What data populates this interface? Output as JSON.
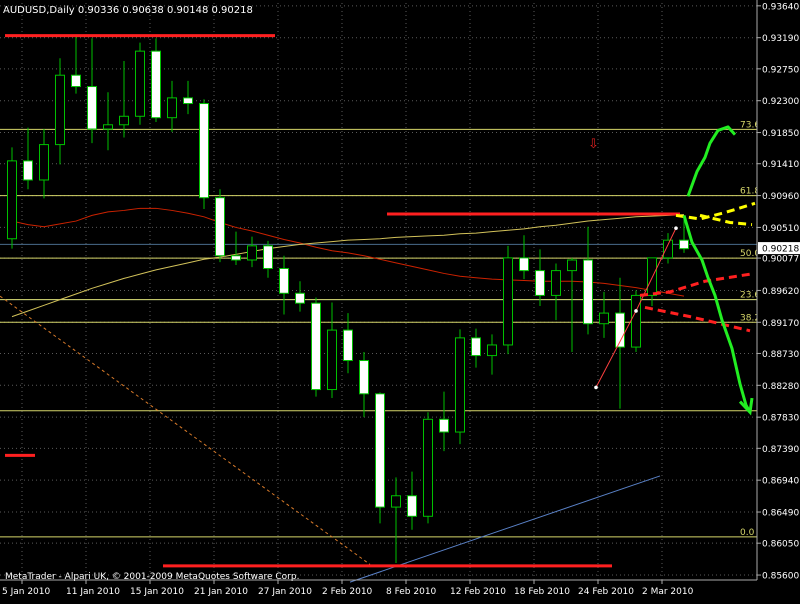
{
  "header": {
    "symbol_line": "AUDUSD,Daily  0.90336 0.90638 0.90148 0.90218",
    "arrow_marker": "⇩"
  },
  "footer": {
    "copyright": "MetaTrader - Alpari UK, © 2001-2009 MetaQuotes Software Corp."
  },
  "colors": {
    "background": "#000000",
    "grid": "#5a5a5a",
    "axis_text": "#ffffff",
    "bull_body": "#000000",
    "bear_body": "#ffffff",
    "wick": "#00c000",
    "candle_outline": "#00c000",
    "ma_red": "#cc2200",
    "ma_yellow": "#d2c25a",
    "fib": "#d6d66a",
    "hline_blue": "#4a6c8c",
    "trend_blue": "#5a82c8",
    "trend_orange": "#d77a2a",
    "red_level": "#ff2020",
    "green_path": "#22ee22",
    "yellow_dash": "#ffff00",
    "current_price_bg": "#ffffff"
  },
  "chart_data": {
    "type": "candlestick",
    "title": "AUDUSD,Daily  0.90336 0.90638 0.90148 0.90218",
    "ylim": [
      0.8553,
      0.9368
    ],
    "y_ticks": [
      "0.93640",
      "0.93190",
      "0.92750",
      "0.92300",
      "0.91850",
      "0.91410",
      "0.90960",
      "0.90510",
      "0.90077",
      "0.89620",
      "0.89170",
      "0.88730",
      "0.88280",
      "0.87830",
      "0.87390",
      "0.86940",
      "0.86490",
      "0.86050",
      "0.85600"
    ],
    "current_price": "0.90218",
    "x_ticks": [
      "5 Jan 2010",
      "11 Jan 2010",
      "15 Jan 2010",
      "21 Jan 2010",
      "27 Jan 2010",
      "2 Feb 2010",
      "8 Feb 2010",
      "12 Feb 2010",
      "18 Feb 2010",
      "24 Feb 2010",
      "2 Mar 2010"
    ],
    "candles": [
      {
        "o": 0.9035,
        "h": 0.9164,
        "l": 0.9021,
        "c": 0.9145
      },
      {
        "o": 0.9145,
        "h": 0.9192,
        "l": 0.9105,
        "c": 0.9118
      },
      {
        "o": 0.9118,
        "h": 0.919,
        "l": 0.9092,
        "c": 0.9168
      },
      {
        "o": 0.9168,
        "h": 0.929,
        "l": 0.914,
        "c": 0.9266
      },
      {
        "o": 0.9266,
        "h": 0.932,
        "l": 0.924,
        "c": 0.925
      },
      {
        "o": 0.925,
        "h": 0.9318,
        "l": 0.917,
        "c": 0.919
      },
      {
        "o": 0.919,
        "h": 0.9242,
        "l": 0.916,
        "c": 0.9196
      },
      {
        "o": 0.9196,
        "h": 0.9286,
        "l": 0.9178,
        "c": 0.9208
      },
      {
        "o": 0.9208,
        "h": 0.9312,
        "l": 0.9196,
        "c": 0.93
      },
      {
        "o": 0.93,
        "h": 0.9318,
        "l": 0.92,
        "c": 0.9206
      },
      {
        "o": 0.9206,
        "h": 0.9258,
        "l": 0.9186,
        "c": 0.9234
      },
      {
        "o": 0.9234,
        "h": 0.9258,
        "l": 0.9211,
        "c": 0.9226
      },
      {
        "o": 0.9226,
        "h": 0.9232,
        "l": 0.9077,
        "c": 0.9093
      },
      {
        "o": 0.9093,
        "h": 0.9105,
        "l": 0.9002,
        "c": 0.9011
      },
      {
        "o": 0.9011,
        "h": 0.9045,
        "l": 0.8998,
        "c": 0.9005
      },
      {
        "o": 0.9005,
        "h": 0.9038,
        "l": 0.8995,
        "c": 0.9025
      },
      {
        "o": 0.9025,
        "h": 0.9032,
        "l": 0.898,
        "c": 0.8993
      },
      {
        "o": 0.8993,
        "h": 0.9011,
        "l": 0.8928,
        "c": 0.8958
      },
      {
        "o": 0.8958,
        "h": 0.8975,
        "l": 0.8932,
        "c": 0.8944
      },
      {
        "o": 0.8944,
        "h": 0.8952,
        "l": 0.8812,
        "c": 0.8822
      },
      {
        "o": 0.8822,
        "h": 0.8945,
        "l": 0.881,
        "c": 0.8906
      },
      {
        "o": 0.8906,
        "h": 0.893,
        "l": 0.8845,
        "c": 0.8863
      },
      {
        "o": 0.8863,
        "h": 0.8875,
        "l": 0.8783,
        "c": 0.8816
      },
      {
        "o": 0.8816,
        "h": 0.8818,
        "l": 0.8633,
        "c": 0.8656
      },
      {
        "o": 0.8656,
        "h": 0.8698,
        "l": 0.8577,
        "c": 0.8672
      },
      {
        "o": 0.8672,
        "h": 0.8706,
        "l": 0.8624,
        "c": 0.8643
      },
      {
        "o": 0.8643,
        "h": 0.879,
        "l": 0.8633,
        "c": 0.878
      },
      {
        "o": 0.878,
        "h": 0.8819,
        "l": 0.8735,
        "c": 0.8762
      },
      {
        "o": 0.8762,
        "h": 0.8907,
        "l": 0.8745,
        "c": 0.8895
      },
      {
        "o": 0.8895,
        "h": 0.8908,
        "l": 0.8853,
        "c": 0.887
      },
      {
        "o": 0.887,
        "h": 0.89,
        "l": 0.8843,
        "c": 0.8885
      },
      {
        "o": 0.8885,
        "h": 0.9025,
        "l": 0.8872,
        "c": 0.9008
      },
      {
        "o": 0.9008,
        "h": 0.904,
        "l": 0.8978,
        "c": 0.899
      },
      {
        "o": 0.899,
        "h": 0.902,
        "l": 0.894,
        "c": 0.8955
      },
      {
        "o": 0.8955,
        "h": 0.9,
        "l": 0.892,
        "c": 0.899
      },
      {
        "o": 0.899,
        "h": 0.9008,
        "l": 0.8875,
        "c": 0.9005
      },
      {
        "o": 0.9005,
        "h": 0.9052,
        "l": 0.89,
        "c": 0.8915
      },
      {
        "o": 0.8915,
        "h": 0.896,
        "l": 0.8895,
        "c": 0.893
      },
      {
        "o": 0.893,
        "h": 0.898,
        "l": 0.8795,
        "c": 0.8882
      },
      {
        "o": 0.8882,
        "h": 0.8962,
        "l": 0.8875,
        "c": 0.8955
      },
      {
        "o": 0.8955,
        "h": 0.9005,
        "l": 0.894,
        "c": 0.9008
      },
      {
        "o": 0.9008,
        "h": 0.9043,
        "l": 0.9,
        "c": 0.9033
      },
      {
        "o": 0.9033,
        "h": 0.9063,
        "l": 0.9015,
        "c": 0.9021
      }
    ],
    "fib_levels": [
      {
        "label": "73.6",
        "value": 0.91895
      },
      {
        "label": "61.8",
        "value": 0.9096
      },
      {
        "label": "50.0",
        "value": 0.90077
      },
      {
        "label": "23.6",
        "value": 0.8949
      },
      {
        "label": "38.2",
        "value": 0.8917
      },
      {
        "label": "0.0",
        "value": 0.8614
      },
      {
        "label": "",
        "value": 0.8792
      }
    ],
    "grid": true
  }
}
